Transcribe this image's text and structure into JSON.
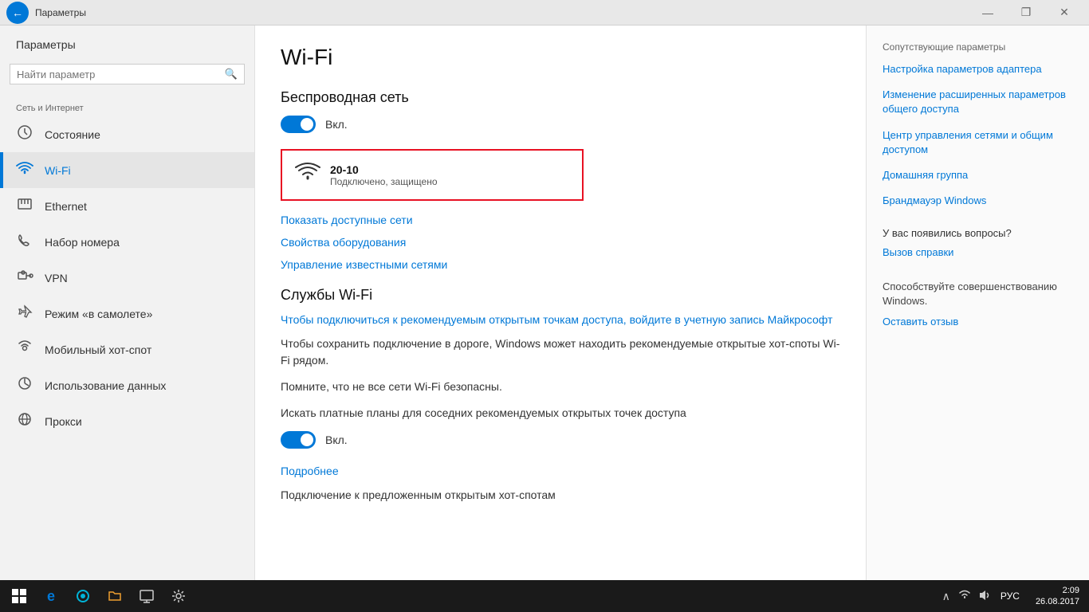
{
  "titlebar": {
    "title": "Параметры",
    "back_icon": "←",
    "minimize": "—",
    "maximize": "❐",
    "close": "✕"
  },
  "sidebar": {
    "search_placeholder": "Найти параметр",
    "section_label": "Сеть и Интернет",
    "nav_items": [
      {
        "id": "status",
        "label": "Состояние",
        "icon": "⊕"
      },
      {
        "id": "wifi",
        "label": "Wi-Fi",
        "icon": "((ω))"
      },
      {
        "id": "ethernet",
        "label": "Ethernet",
        "icon": "⊡"
      },
      {
        "id": "dialup",
        "label": "Набор номера",
        "icon": "☎"
      },
      {
        "id": "vpn",
        "label": "VPN",
        "icon": "⊞"
      },
      {
        "id": "airplane",
        "label": "Режим «в самолете»",
        "icon": "✈"
      },
      {
        "id": "hotspot",
        "label": "Мобильный хот-спот",
        "icon": "◉"
      },
      {
        "id": "data",
        "label": "Использование данных",
        "icon": "⊙"
      },
      {
        "id": "proxy",
        "label": "Прокси",
        "icon": "⊗"
      }
    ]
  },
  "content": {
    "page_title": "Wi-Fi",
    "wireless_section_title": "Беспроводная сеть",
    "toggle_on_label": "Вкл.",
    "network_name": "20-10",
    "network_status": "Подключено, защищено",
    "link_show_networks": "Показать доступные сети",
    "link_hardware_props": "Свойства оборудования",
    "link_manage_networks": "Управление известными сетями",
    "wifi_services_title": "Службы Wi-Fi",
    "wifi_services_link": "Чтобы подключиться к рекомендуемым открытым точкам доступа, войдите в учетную запись Майкрософт",
    "text1": "Чтобы сохранить подключение в дороге, Windows может находить рекомендуемые открытые хот-споты Wi-Fi рядом.",
    "text2": "Помните, что не все сети Wi-Fi безопасны.",
    "text3": "Искать платные планы для соседних рекомендуемых открытых точек доступа",
    "toggle2_label": "Вкл.",
    "link_details": "Подробнее",
    "text4": "Подключение к предложенным открытым хот-спотам"
  },
  "right_panel": {
    "section_title": "Сопутствующие параметры",
    "links": [
      "Настройка параметров адаптера",
      "Изменение расширенных параметров общего доступа",
      "Центр управления сетями и общим доступом",
      "Домашняя группа",
      "Брандмауэр Windows"
    ],
    "questions_title": "У вас появились вопросы?",
    "questions_link": "Вызов справки",
    "improve_title": "Способствуйте совершенствованию Windows.",
    "improve_link": "Оставить отзыв"
  },
  "taskbar": {
    "time": "2:09",
    "date": "26.08.2017",
    "lang": "РУС",
    "apps": [
      "⊞",
      "e",
      "◉",
      "📁",
      "🖥",
      "⚙"
    ]
  }
}
